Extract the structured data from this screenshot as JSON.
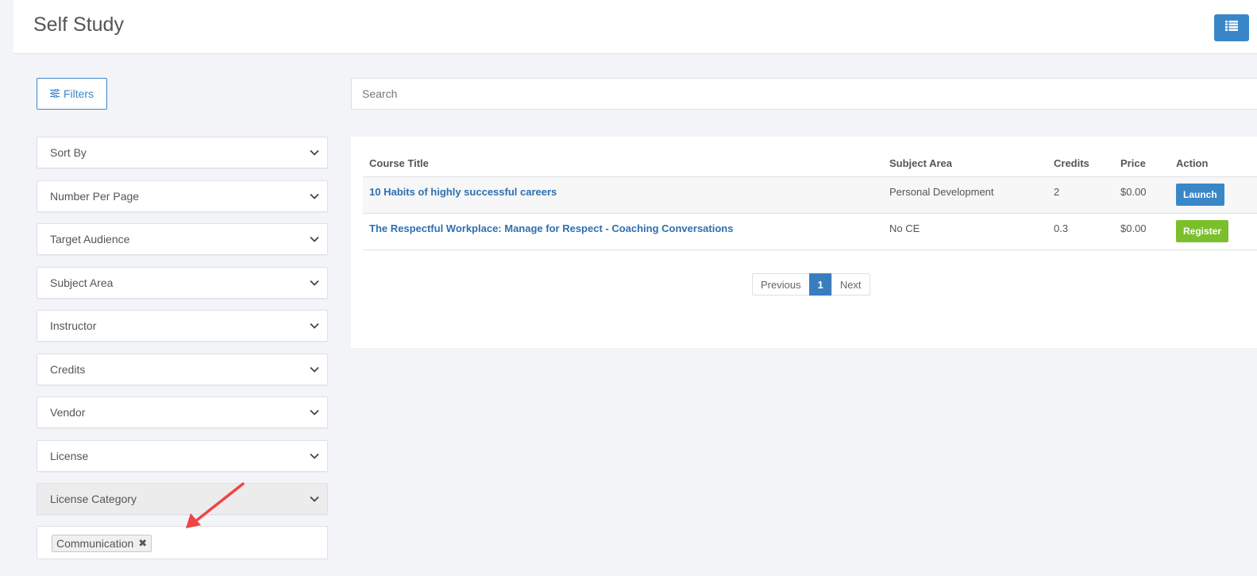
{
  "header": {
    "title": "Self Study",
    "menu_icon": "list-icon"
  },
  "toolbar": {
    "filters_label": "Filters",
    "filters_icon": "sliders-icon",
    "search_placeholder": "Search"
  },
  "filters": {
    "sort_by": "Sort By",
    "number_per_page": "Number Per Page",
    "target_audience": "Target Audience",
    "subject_area": "Subject Area",
    "instructor": "Instructor",
    "credits": "Credits",
    "vendor": "Vendor",
    "license": "License",
    "license_category": "License Category",
    "selected_tag": "Communication",
    "remove_tag_glyph": "✖"
  },
  "table": {
    "columns": {
      "title": "Course Title",
      "subject": "Subject Area",
      "credits": "Credits",
      "price": "Price",
      "action": "Action"
    },
    "rows": [
      {
        "title": "10 Habits of highly successful careers",
        "subject": "Personal Development",
        "credits": "2",
        "price": "$0.00",
        "action": "Launch"
      },
      {
        "title": "The Respectful Workplace: Manage for Respect - Coaching Conversations",
        "subject": "No CE",
        "credits": "0.3",
        "price": "$0.00",
        "action": "Register"
      }
    ]
  },
  "pagination": {
    "previous": "Previous",
    "current": "1",
    "next": "Next"
  },
  "colors": {
    "primary": "#3a87c8",
    "success": "#7bbf2c",
    "annotation": "#ef4444"
  }
}
